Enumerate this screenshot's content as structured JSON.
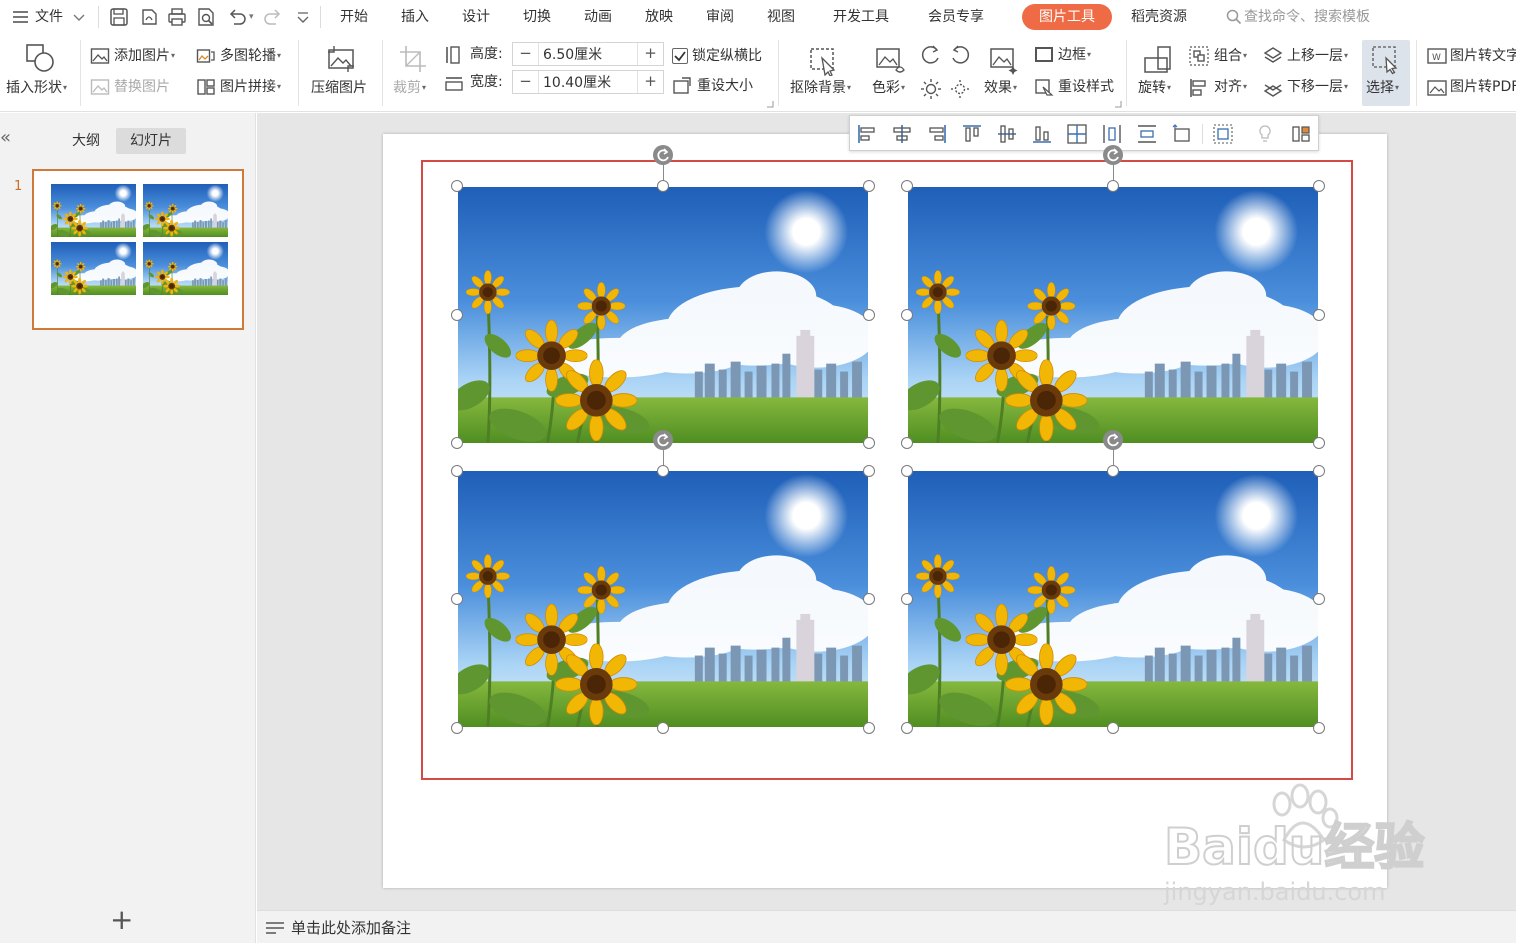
{
  "menu": {
    "file": "文件",
    "tabs": [
      "开始",
      "插入",
      "设计",
      "切换",
      "动画",
      "放映",
      "审阅",
      "视图",
      "开发工具",
      "会员专享"
    ],
    "active_tab": "图片工具",
    "resources": "稻壳资源",
    "search_placeholder": "查找命令、搜索模板"
  },
  "ribbon": {
    "insert_shape": "插入形状",
    "add_picture": "添加图片",
    "replace_picture": "替换图片",
    "multi_carousel": "多图轮播",
    "picture_splice": "图片拼接",
    "compress_picture": "压缩图片",
    "crop": "裁剪",
    "height_label": "高度:",
    "height_value": "6.50厘米",
    "width_label": "宽度:",
    "width_value": "10.40厘米",
    "lock_ratio": "锁定纵横比",
    "reset_size": "重设大小",
    "remove_bg": "抠除背景",
    "color": "色彩",
    "effects": "效果",
    "border": "边框",
    "reset_style": "重设样式",
    "rotate": "旋转",
    "group": "组合",
    "align": "对齐",
    "bring_forward": "上移一层",
    "send_backward": "下移一层",
    "select": "选择",
    "pic_to_text": "图片转文字",
    "pic_to_pdf": "图片转PDF"
  },
  "left_panel": {
    "tab_outline": "大纲",
    "tab_slides": "幻灯片",
    "slide_number": "1",
    "add_slide_symbol": "+"
  },
  "notes": {
    "placeholder": "单击此处添加备注"
  },
  "watermark": {
    "text": "Baidu经验",
    "url": "jingyan.baidu.com"
  },
  "colors": {
    "accent_tab": "#ee6b45",
    "selection_border": "#d44a45",
    "thumb_border": "#d07a3a"
  }
}
